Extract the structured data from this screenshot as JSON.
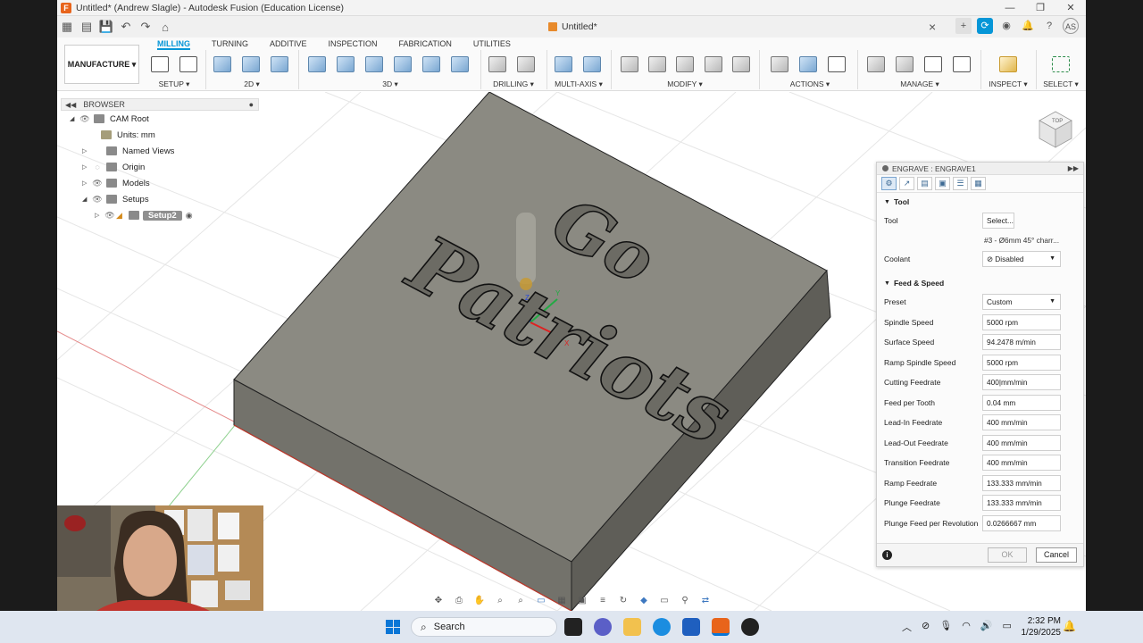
{
  "window": {
    "title": "Untitled* (Andrew Slagle) - Autodesk Fusion (Education License)",
    "controls": [
      "—",
      "❐",
      "✕"
    ]
  },
  "doc_tab": {
    "label": "Untitled*"
  },
  "user": {
    "initials": "AS"
  },
  "ribbon": {
    "workspace": "MANUFACTURE",
    "tabs": [
      "MILLING",
      "TURNING",
      "ADDITIVE",
      "INSPECTION",
      "FABRICATION",
      "UTILITIES"
    ],
    "active_tab": "MILLING",
    "groups": [
      "SETUP ▾",
      "2D ▾",
      "3D ▾",
      "DRILLING ▾",
      "MULTI-AXIS ▾",
      "MODIFY ▾",
      "ACTIONS ▾",
      "MANAGE ▾",
      "INSPECT ▾",
      "SELECT ▾"
    ]
  },
  "browser": {
    "header": "BROWSER",
    "items": [
      {
        "label": "CAM Root"
      },
      {
        "label": "Units: mm"
      },
      {
        "label": "Named Views"
      },
      {
        "label": "Origin"
      },
      {
        "label": "Models"
      },
      {
        "label": "Setups"
      },
      {
        "label": "Setup2"
      }
    ]
  },
  "viewport": {
    "text_top": "Go",
    "text_bottom": "Patriots"
  },
  "engrave_panel": {
    "title": "ENGRAVE : ENGRAVE1",
    "tool_section": "Tool",
    "tool_label": "Tool",
    "tool_button": "Select...",
    "tool_name": "#3 - Ø6mm 45° charr...",
    "coolant_label": "Coolant",
    "coolant_value": "Disabled",
    "feed_section": "Feed & Speed",
    "preset_label": "Preset",
    "preset_value": "Custom",
    "rows": [
      {
        "label": "Spindle Speed",
        "value": "5000 rpm"
      },
      {
        "label": "Surface Speed",
        "value": "94.2478 m/min"
      },
      {
        "label": "Ramp Spindle Speed",
        "value": "5000 rpm"
      },
      {
        "label": "Cutting Feedrate",
        "value": "400|mm/min"
      },
      {
        "label": "Feed per Tooth",
        "value": "0.04 mm"
      },
      {
        "label": "Lead-In Feedrate",
        "value": "400 mm/min"
      },
      {
        "label": "Lead-Out Feedrate",
        "value": "400 mm/min"
      },
      {
        "label": "Transition Feedrate",
        "value": "400 mm/min"
      },
      {
        "label": "Ramp Feedrate",
        "value": "133.333 mm/min"
      },
      {
        "label": "Plunge Feedrate",
        "value": "133.333 mm/min"
      },
      {
        "label": "Plunge Feed per Revolution",
        "value": "0.0266667 mm"
      }
    ],
    "ok": "OK",
    "cancel": "Cancel"
  },
  "taskbar": {
    "search_placeholder": "Search",
    "time": "2:32 PM",
    "date": "1/29/2025"
  },
  "colors": {
    "accent": "#0696d7",
    "block_top": "#8b8a82",
    "block_side": "#6e6d66"
  }
}
